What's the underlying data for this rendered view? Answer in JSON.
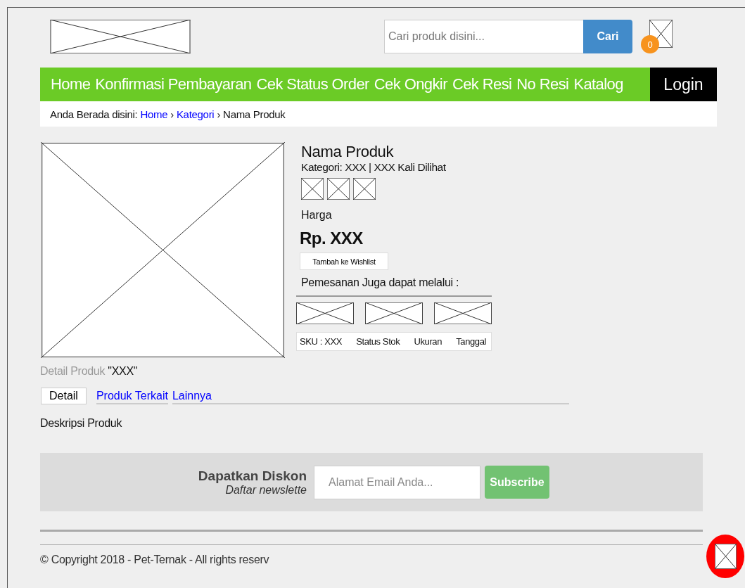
{
  "header": {
    "search_placeholder": "Cari produk disini...",
    "search_button": "Cari",
    "cart_count": "0"
  },
  "nav": {
    "items": [
      "Home",
      "Konfirmasi Pembayaran",
      "Cek Status Order",
      "Cek Ongkir",
      "Cek Resi",
      "No Resi",
      "Katalog"
    ],
    "login": "Login"
  },
  "breadcrumb": {
    "prefix": "Anda Berada disini:",
    "links": [
      "Home",
      "Kategori"
    ],
    "separator": "›",
    "current": "Nama Produk"
  },
  "product": {
    "name": "Nama Produk",
    "meta": "Kategori: XXX | XXX Kali Dilihat",
    "price_label": "Harga",
    "price": "Rp. XXX",
    "wishlist_button": "Tambah ke Wishlist",
    "order_via": "Pemesanan Juga dapat melalui :",
    "info": [
      "SKU : XXX",
      "Status Stok",
      "Ukuran",
      "Tanggal"
    ],
    "detail_label": "Detail Produk",
    "detail_value": "\"XXX\""
  },
  "tabs": [
    {
      "label": "Detail",
      "selected": true
    },
    {
      "label": "Produk Terkait",
      "selected": false
    },
    {
      "label": "Lainnya",
      "selected": false
    }
  ],
  "description": "Deskripsi Produk",
  "newsletter": {
    "title": "Dapatkan Diskon",
    "subtitle": "Daftar newslette",
    "placeholder": "Alamat Email Anda...",
    "button": "Subscribe"
  },
  "footer": {
    "copyright": "© Copyright 2018 - Pet-Ternak - All rights reserv"
  }
}
